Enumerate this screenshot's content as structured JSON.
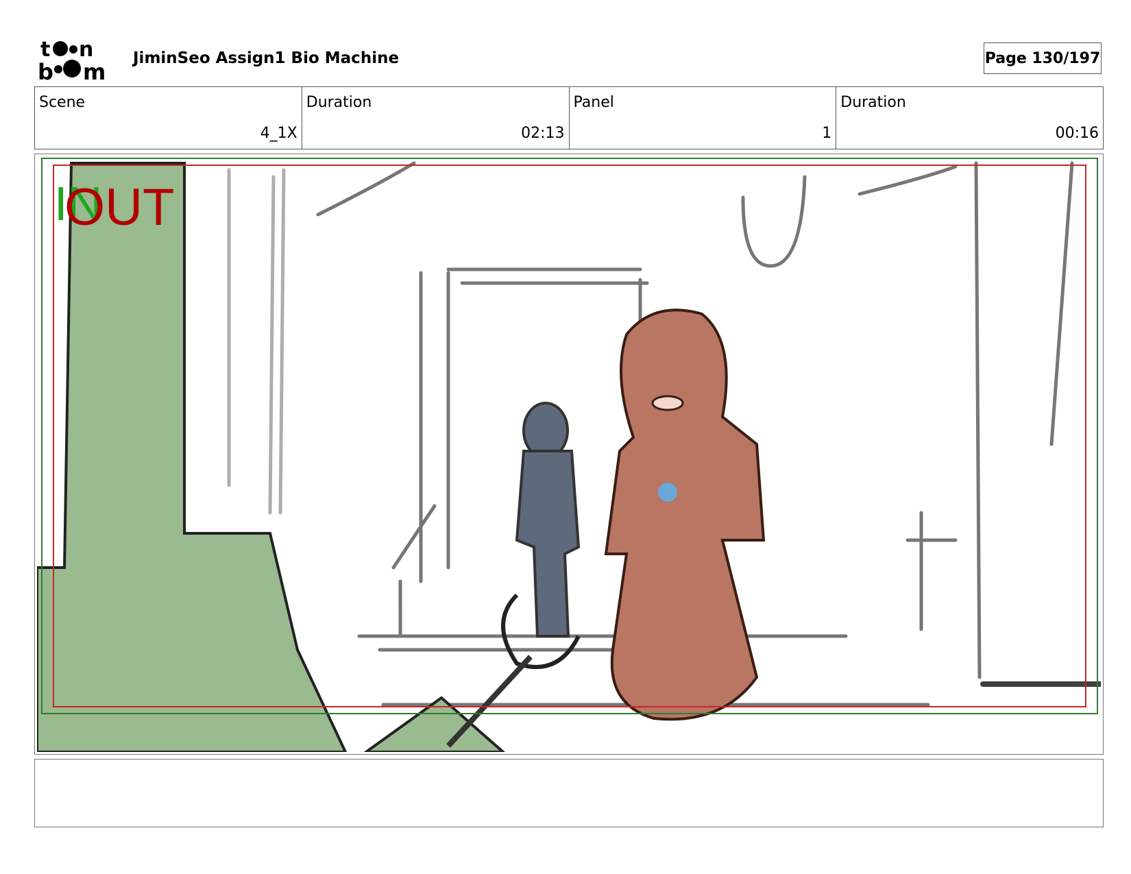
{
  "header": {
    "logo_text": "toon boom",
    "title": "JiminSeo Assign1 Bio Machine",
    "page": "Page 130/197"
  },
  "info": [
    {
      "label": "Scene",
      "value": "4_1X"
    },
    {
      "label": "Duration",
      "value": "02:13"
    },
    {
      "label": "Panel",
      "value": "1"
    },
    {
      "label": "Duration",
      "value": "00:16"
    }
  ],
  "panel": {
    "in_label": "IN",
    "out_label": "OUT",
    "colors": {
      "in": "#1fa81f",
      "out": "#b00000",
      "safe_frame": "#2e7d32",
      "action_frame": "#c62828"
    }
  },
  "notes": ""
}
